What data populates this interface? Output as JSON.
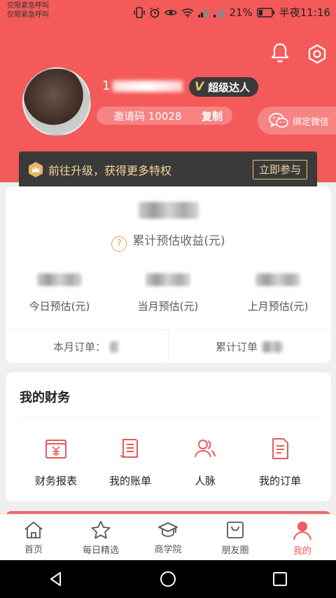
{
  "status_bar": {
    "left_line1": "仅限紧急呼叫",
    "left_line2": "仅限紧急呼叫",
    "battery": "21%",
    "time": "半夜11:16"
  },
  "profile": {
    "user_prefix": "1",
    "level_badge": "超级达人",
    "level_letter": "V",
    "invite_label": "邀请码 10028",
    "copy_label": "复制",
    "wechat_label": "绑定微信"
  },
  "upgrade": {
    "text": "前往升级，获得更多特权",
    "button": "立即参与"
  },
  "earnings": {
    "total_label": "累计预估收益(元)",
    "question_mark": "?",
    "today_label": "今日预估(元)",
    "month_label": "当月预估(元)",
    "last_month_label": "上月预估(元)",
    "month_orders_label": "本月订单：",
    "total_orders_label": "累计订单"
  },
  "finance": {
    "title": "我的财务",
    "items": [
      "财务报表",
      "我的账单",
      "人脉",
      "我的订单"
    ]
  },
  "tabs": [
    "首页",
    "每日精选",
    "商学院",
    "朋友圈",
    "我的"
  ],
  "colors": {
    "accent": "#f45a5a",
    "dark": "#3a3a3a",
    "gold": "#f5d79a"
  }
}
